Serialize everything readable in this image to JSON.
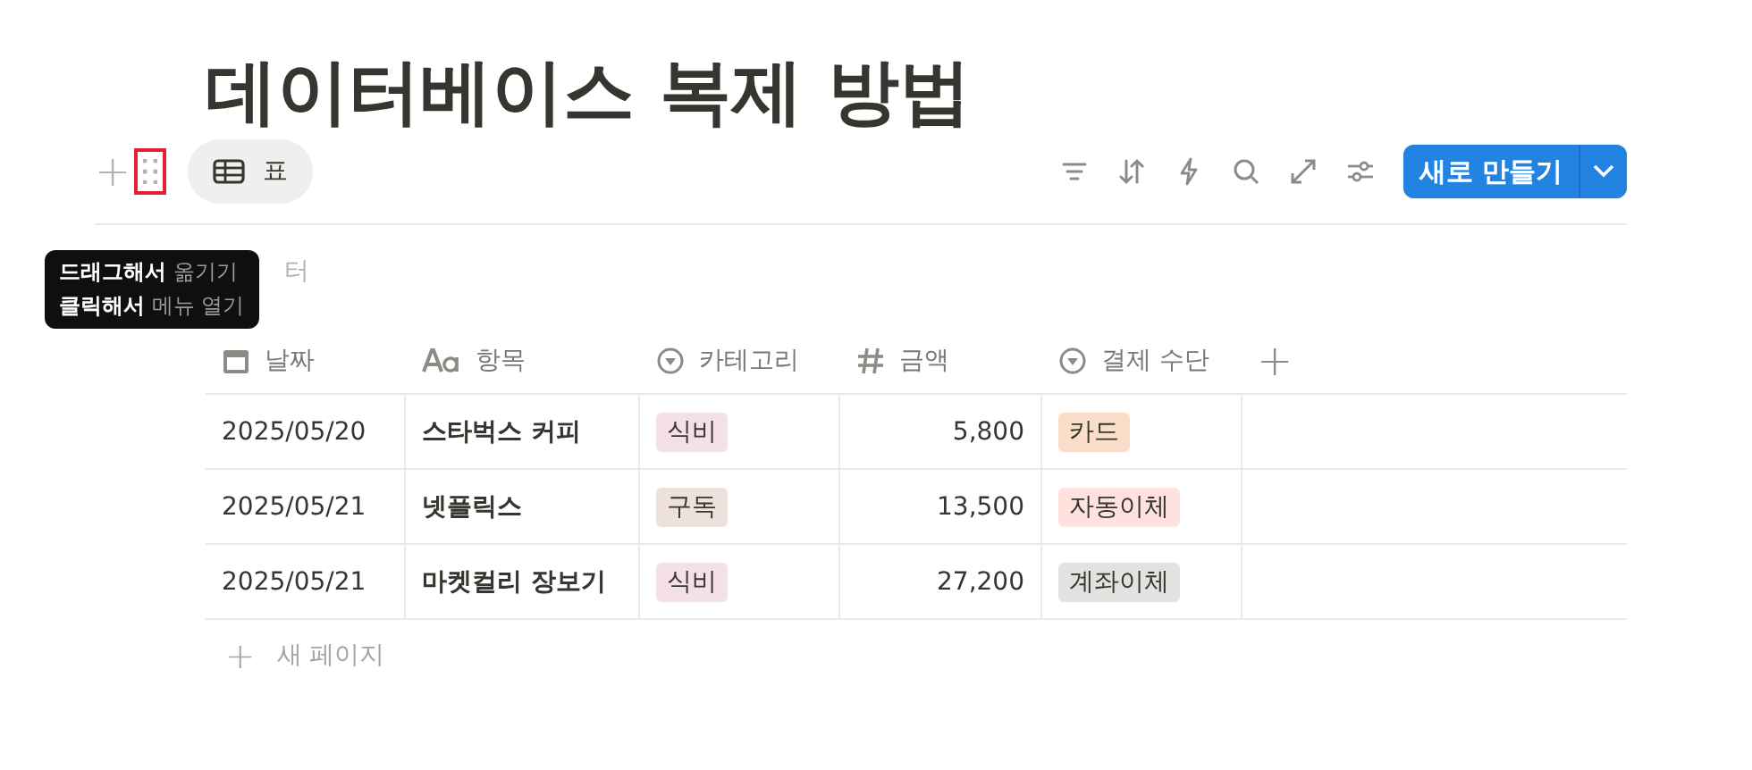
{
  "title": "데이터베이스 복제 방법",
  "toolbar": {
    "add_icon": "+",
    "drag_handle": {
      "highlighted": true
    },
    "view_tab": {
      "label": "표",
      "selected": true
    },
    "new_button": {
      "label": "새로 만들기"
    }
  },
  "tooltip": {
    "lines": [
      {
        "strong": "드래그해서",
        "rest": "옮기기"
      },
      {
        "strong": "클릭해서",
        "rest": "메뉴 열기"
      }
    ]
  },
  "filter_hint": "터",
  "table": {
    "columns": [
      {
        "label": "날짜",
        "kind": "date"
      },
      {
        "label": "항목",
        "kind": "text"
      },
      {
        "label": "카테고리",
        "kind": "select"
      },
      {
        "label": "금액",
        "kind": "number"
      },
      {
        "label": "결제 수단",
        "kind": "select"
      }
    ],
    "add_column": "+",
    "rows": [
      {
        "cells": [
          {
            "text": "2025/05/20"
          },
          {
            "text": "스타벅스 커피"
          },
          {
            "text": "식비",
            "color": "#f5e0e9"
          },
          {
            "text": "5,800"
          },
          {
            "text": "카드",
            "color": "#fadec9"
          }
        ]
      },
      {
        "cells": [
          {
            "text": "2025/05/21"
          },
          {
            "text": "넷플릭스"
          },
          {
            "text": "구독",
            "color": "#eee0da"
          },
          {
            "text": "13,500"
          },
          {
            "text": "자동이체",
            "color": "#ffe2dd"
          }
        ]
      },
      {
        "cells": [
          {
            "text": "2025/05/21"
          },
          {
            "text": "마켓컬리 장보기"
          },
          {
            "text": "식비",
            "color": "#f5e0e9"
          },
          {
            "text": "27,200"
          },
          {
            "text": "계좌이체",
            "color": "#e3e2e0"
          }
        ]
      }
    ],
    "new_page": {
      "icon": "+",
      "label": "새 페이지"
    }
  }
}
